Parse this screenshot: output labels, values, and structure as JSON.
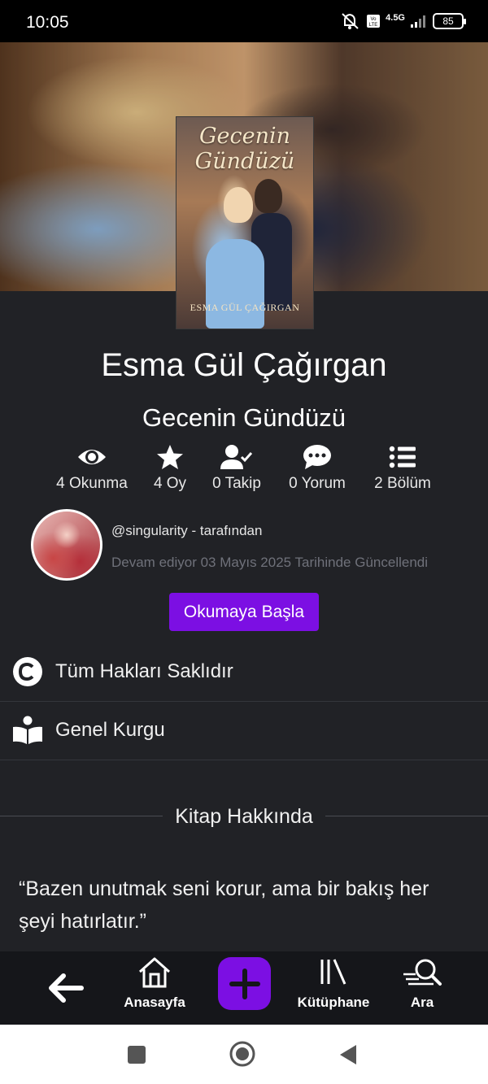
{
  "status_bar": {
    "time": "10:05",
    "battery": "85",
    "network": "4.5G"
  },
  "cover": {
    "title_line1": "Gecenin",
    "title_line2": "Gündüzü",
    "author": "ESMA GÜL ÇAĞIRGAN"
  },
  "author_name": "Esma Gül Çağırgan",
  "book_title": "Gecenin Gündüzü",
  "stats": {
    "reads": "4 Okunma",
    "votes": "4 Oy",
    "follows": "0 Takip",
    "comments": "0 Yorum",
    "chapters": "2 Bölüm"
  },
  "uploader": {
    "username": "@singularity - tarafından",
    "updated": "Devam ediyor 03 Mayıs 2025 Tarihinde Güncellendi"
  },
  "read_button": "Okumaya Başla",
  "info": {
    "copyright": "Tüm Hakları Saklıdır",
    "genre": "Genel Kurgu"
  },
  "about": {
    "title": "Kitap Hakkında",
    "quote": "“Bazen unutmak seni korur, ama bir bakış her şeyi hatırlatır.”"
  },
  "bottom_nav": {
    "home": "Anasayfa",
    "library": "Kütüphane",
    "search": "Ara"
  },
  "colors": {
    "accent": "#7c0fe3",
    "background": "#212226",
    "nav": "#15161a"
  }
}
